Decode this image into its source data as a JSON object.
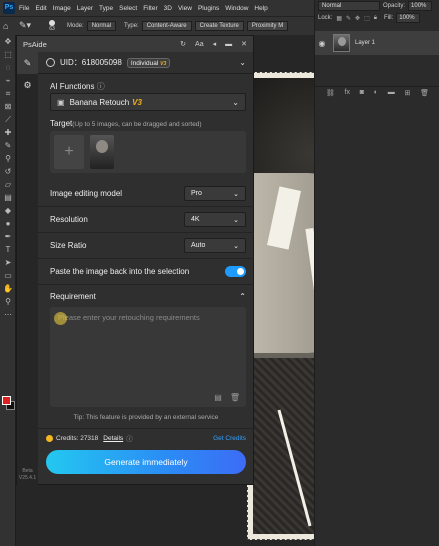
{
  "menubar": {
    "logo": "Ps",
    "items": [
      "File",
      "Edit",
      "Image",
      "Layer",
      "Type",
      "Select",
      "Filter",
      "3D",
      "View",
      "Plugins",
      "Window",
      "Help"
    ]
  },
  "options_bar": {
    "brush_size": "63",
    "mode_label": "Mode:",
    "mode_value": "Normal",
    "type_label": "Type:",
    "content_aware": "Content-Aware",
    "create_texture": "Create Texture",
    "proximity_match": "Proximity M"
  },
  "layers_panel": {
    "blend_mode": "Normal",
    "opacity_label": "Opacity:",
    "opacity_value": "100%",
    "lock_label": "Lock:",
    "fill_label": "Fill:",
    "fill_value": "100%",
    "layer_name": "Layer 1",
    "footer_fx": "fx"
  },
  "plugin": {
    "title": "PsAide",
    "titlebar_icons": [
      "refresh-icon",
      "font-size-icon",
      "back-icon",
      "minimize-icon",
      "close-icon"
    ],
    "version_label": "Beta",
    "version_value": "V25.4.1",
    "uid": "UID：618005098",
    "badge": "Individual",
    "badge_tag": "V3",
    "ai_functions_label": "AI Functions",
    "function_selected": "Banana Retouch",
    "function_tag": "V3",
    "target_label": "Target",
    "target_hint": "(Up to 5 images, can be dragged and sorted)",
    "image_model_label": "Image editing model",
    "image_model_value": "Pro",
    "resolution_label": "Resolution",
    "resolution_value": "4K",
    "size_ratio_label": "Size Ratio",
    "size_ratio_value": "Auto",
    "paste_back_label": "Paste the image back into the selection",
    "paste_back_on": true,
    "requirement_label": "Requirement",
    "requirement_placeholder": "Please enter your retouching requirements",
    "tip": "Tip: This feature is provided by an external service",
    "credits_label": "Credits: 27318",
    "details_label": "Details",
    "get_credits_label": "Get Credits",
    "generate_label": "Generate immediately",
    "accent_color": "#1e9bff",
    "gold_color": "#f0b020"
  }
}
